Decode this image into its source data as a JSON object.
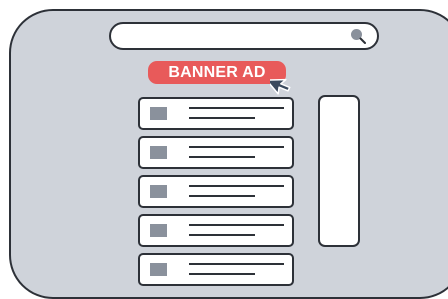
{
  "search": {
    "icon": "search-icon"
  },
  "banner_ad": {
    "label": "BANNER AD",
    "color": "#e85a5a"
  },
  "cursor": {
    "icon": "mouse-pointer-icon"
  },
  "list": {
    "item_count": 5,
    "thumb_icon": "image-placeholder-icon"
  },
  "colors": {
    "panel": "#cfd3da",
    "outline": "#2d3138",
    "thumb": "#8a919c"
  }
}
